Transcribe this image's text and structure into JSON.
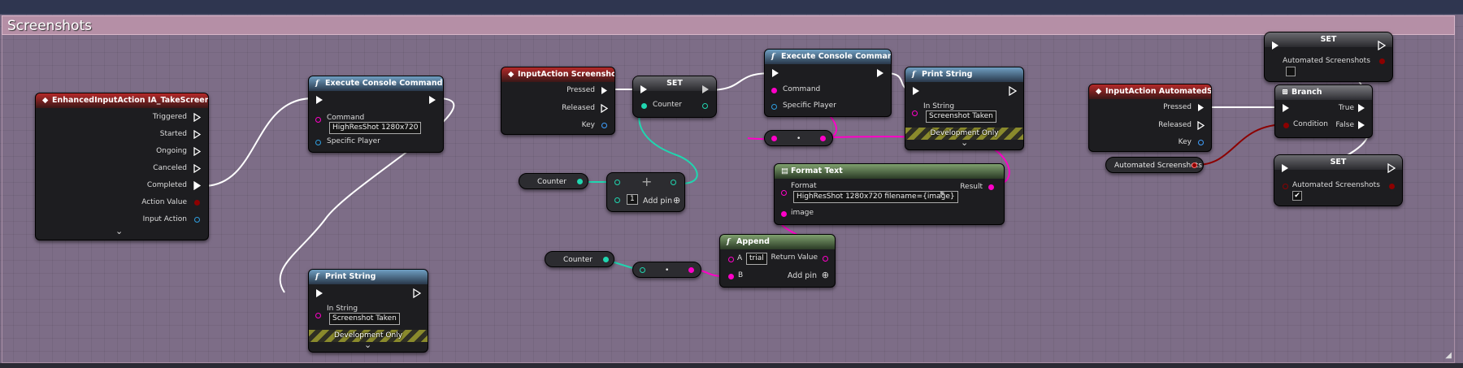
{
  "comment": {
    "title": "Screenshots"
  },
  "colors": {
    "exec": "#ffffff",
    "string": "#ff00c8",
    "int": "#20d6b0",
    "bool": "#8c0000",
    "enhanced_input": "#2f9fe0",
    "struct": "#3fa0ff"
  },
  "nodes": {
    "enhanced": {
      "title": "EnhancedInputAction IA_TakeScreenshot",
      "pins": [
        "Triggered",
        "Started",
        "Ongoing",
        "Canceled",
        "Completed",
        "Action Value",
        "Input Action"
      ],
      "expand": "⌄"
    },
    "exec1": {
      "title": "Execute Console Command",
      "command_label": "Command",
      "command_value": "HighResShot 1280x720",
      "player_label": "Specific Player"
    },
    "print1": {
      "title": "Print String",
      "in_label": "In String",
      "in_value": "Screenshot Taken",
      "dev": "Development Only",
      "expand": "⌄"
    },
    "ia_ss": {
      "title": "InputAction Screenshot",
      "pins": [
        "Pressed",
        "Released",
        "Key"
      ]
    },
    "set1": {
      "title": "SET",
      "counter": "Counter"
    },
    "counter_get1": {
      "label": "Counter"
    },
    "plus": {
      "symbol": "+",
      "value": "1",
      "add_pin": "Add pin"
    },
    "counter_get2": {
      "label": "Counter"
    },
    "conv1": {
      "symbol": "•"
    },
    "append": {
      "title": "Append",
      "a_label": "A",
      "a_value": "trial",
      "b_label": "B",
      "return_label": "Return Value",
      "add_pin": "Add pin"
    },
    "exec2": {
      "title": "Execute Console Command",
      "command_label": "Command",
      "player_label": "Specific Player"
    },
    "conv2": {
      "symbol": "•"
    },
    "format": {
      "title": "Format Text",
      "format_label": "Format",
      "format_value": "HighResShot 1280x720 filename={image}",
      "result_label": "Result",
      "image_label": "image"
    },
    "print2": {
      "title": "Print String",
      "in_label": "In String",
      "in_value": "Screenshot Taken",
      "dev": "Development Only",
      "expand": "⌄"
    },
    "ia_auto": {
      "title": "InputAction AutomatedSS",
      "pins": [
        "Pressed",
        "Released",
        "Key"
      ]
    },
    "auto_get": {
      "label": "Automated Screenshots"
    },
    "set_top": {
      "title": "SET",
      "var": "Automated Screenshots",
      "checked": false
    },
    "branch": {
      "title": "Branch",
      "condition": "Condition",
      "true": "True",
      "false": "False"
    },
    "set_bot": {
      "title": "SET",
      "var": "Automated Screenshots",
      "checked": true,
      "check_glyph": "✔"
    }
  }
}
